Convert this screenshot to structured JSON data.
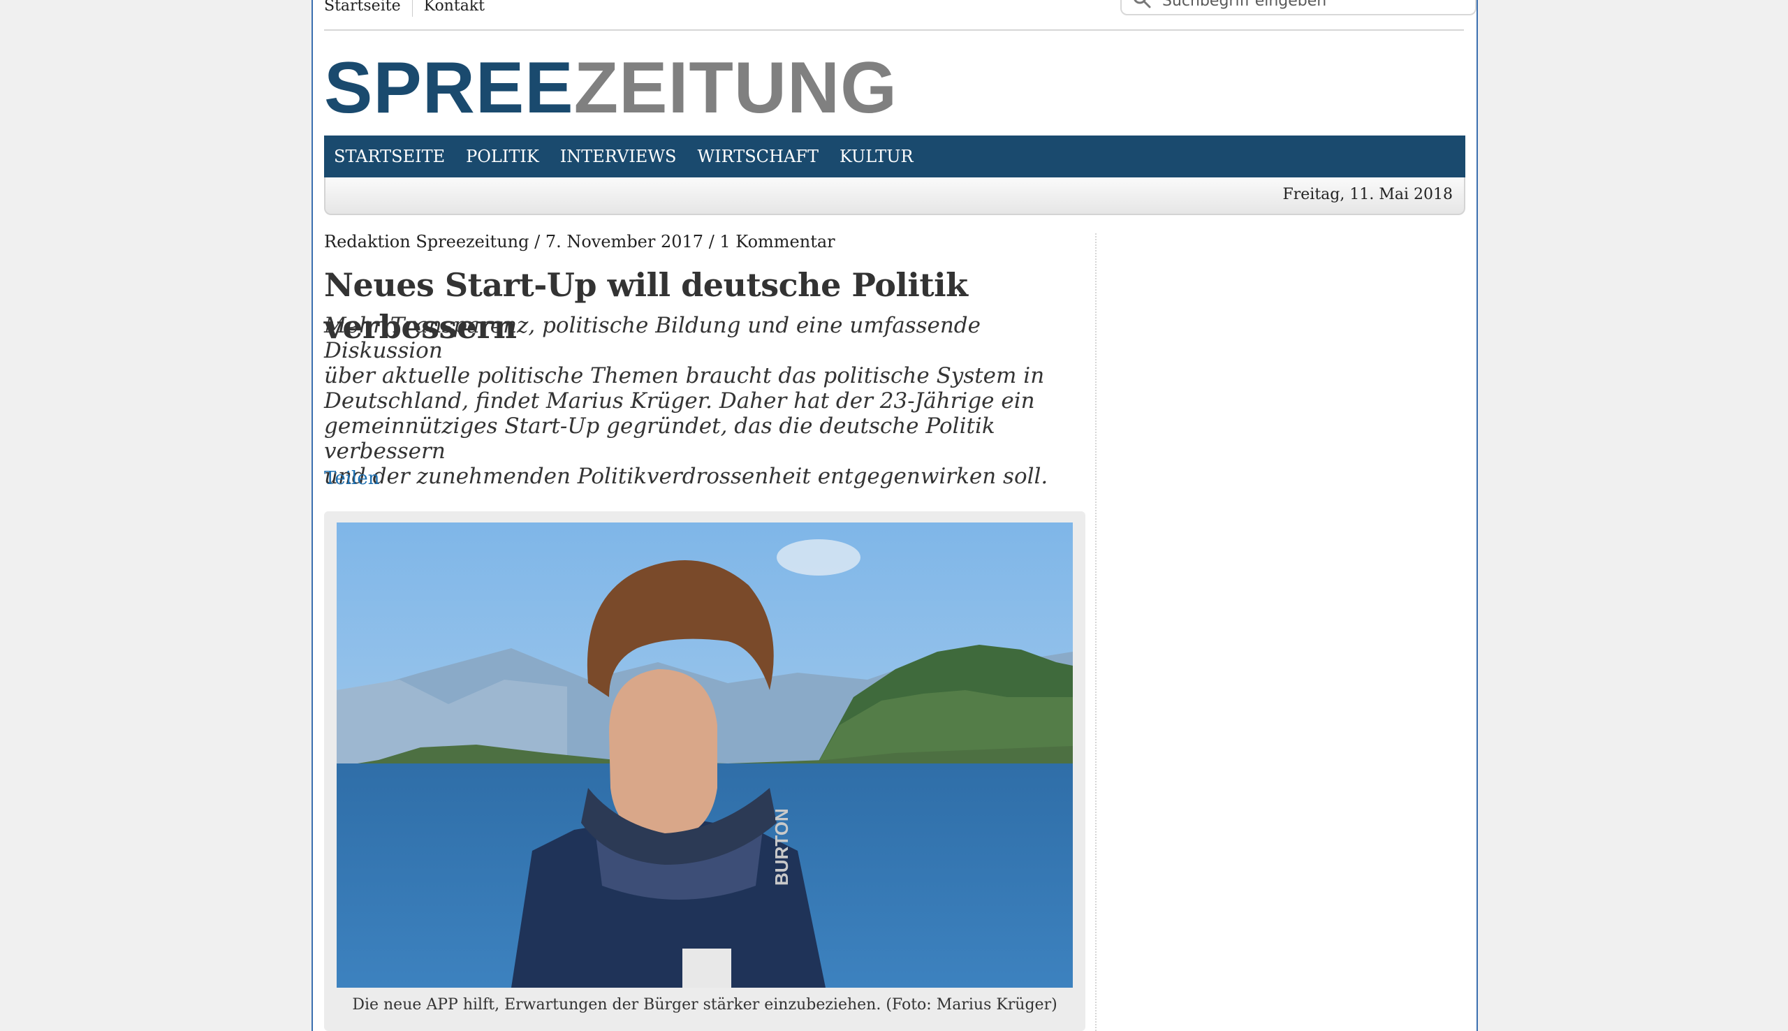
{
  "topbar": {
    "links": [
      "Startseite",
      "Kontakt"
    ],
    "search_placeholder": "Suchbegriff eingeben"
  },
  "logo": {
    "part1": "SPREE",
    "part2": "ZEITUNG"
  },
  "nav": {
    "items": [
      "STARTSEITE",
      "POLITIK",
      "INTERVIEWS",
      "WIRTSCHAFT",
      "KULTUR"
    ]
  },
  "date": "Freitag, 11. Mai 2018",
  "article": {
    "meta": "Redaktion Spreezeitung / 7. November 2017 / 1 Kommentar",
    "headline": "Neues Start-Up will deutsche Politik verbessern",
    "lead_lines": [
      "Mehr Transparenz, politische Bildung und eine umfassende Diskussion",
      "über aktuelle politische Themen braucht das politische System in",
      "Deutschland, findet Marius Krüger. Daher hat der 23-Jährige ein",
      "gemeinnütziges Start-Up gegründet, das die deutsche Politik verbessern",
      "und der zunehmenden Politikverdrossenheit entgegenwirken soll."
    ],
    "share_label": "Teilen",
    "caption": "Die neue APP hilft, Erwartungen der Bürger stärker einzubeziehen. (Foto: Marius Krüger)",
    "photo_print": "BURTON"
  },
  "colors": {
    "brand_blue": "#1a4a6e",
    "brand_grey": "#808080",
    "link": "#1d6fb0"
  }
}
